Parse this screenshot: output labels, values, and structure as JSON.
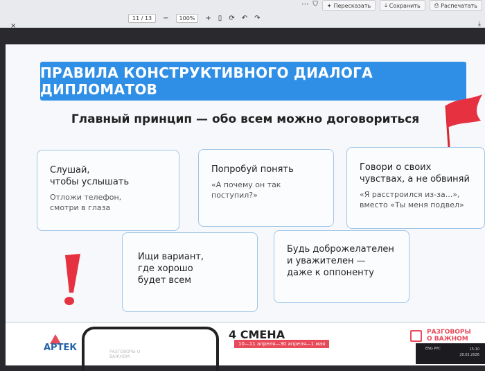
{
  "viewer": {
    "page_indicator": "11 / 13",
    "zoom": "100%",
    "zoom_out": "−",
    "zoom_in": "+",
    "actions": [
      {
        "label": "Пересказать",
        "icon": "sparkle-icon"
      },
      {
        "label": "Сохранить",
        "icon": "download-icon"
      },
      {
        "label": "Распечатать",
        "icon": "printer-icon"
      }
    ]
  },
  "slide": {
    "title": "ПРАВИЛА КОНСТРУКТИВНОГО ДИАЛОГА ДИПЛОМАТОВ",
    "subtitle": "Главный принцип — обо всем можно договориться",
    "cards": [
      {
        "head": "Слушай,\nчтобы услышать",
        "note": "Отложи телефон,\nсмотри в глаза"
      },
      {
        "head": "Попробуй понять",
        "note": "«А почему он так\nпоступил?»"
      },
      {
        "head": "Говори о своих\nчувствах, а не обвиняй",
        "note": "«Я расстроился из-за...»,\nвместо «Ты меня подвел»"
      },
      {
        "head": "Ищи вариант,\nгде хорошо\nбудет всем",
        "note": ""
      },
      {
        "head": "Будь доброжелателен\nи уважителен —\nдаже к оппоненту",
        "note": ""
      }
    ]
  },
  "footer": {
    "brand": "АРТЕК",
    "phone_label": "РАЗГОВОРЫ О ВАЖНОМ",
    "smena": "4 СМЕНА",
    "dates": "10—11 апреля—30 апреля—1 мая",
    "project": "РАЗГОВОРЫ\nО ВАЖНОМ"
  },
  "taskbar": {
    "tray": "ENG  РУС",
    "time": "15:10",
    "date": "20.02.2026"
  },
  "colors": {
    "title_bar": "#2f8fe6",
    "card_border": "#9ec6e6",
    "accent_red": "#e84a5a"
  }
}
